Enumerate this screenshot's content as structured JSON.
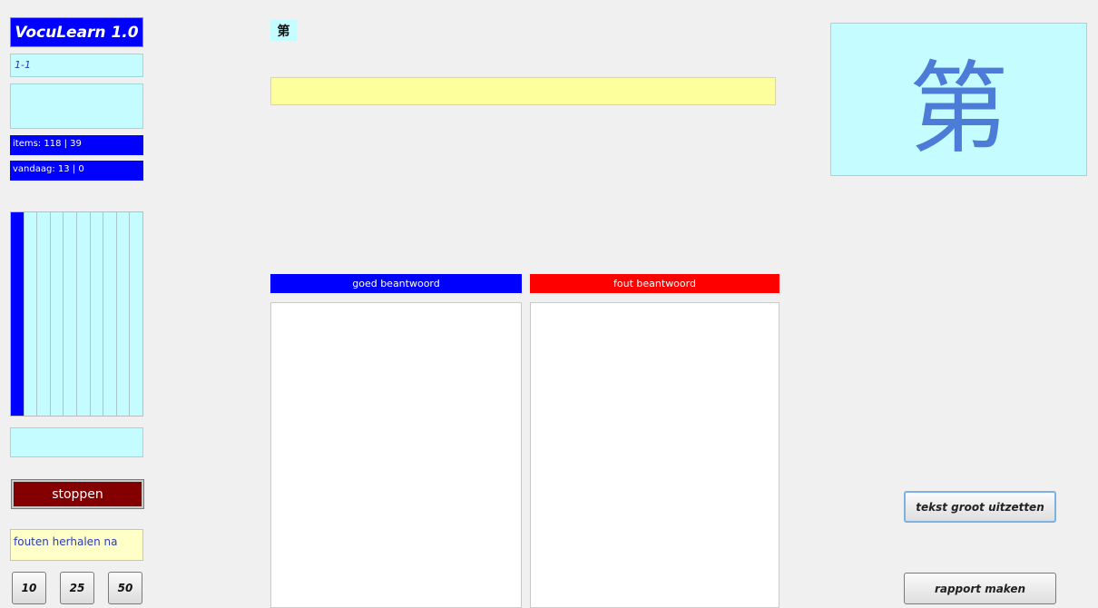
{
  "app": {
    "title": "VocuLearn 1.0"
  },
  "sidebar": {
    "lesson": "1-1",
    "items_stat": "items: 118 | 39",
    "today_stat": "vandaag: 13 | 0",
    "progress_bars": [
      1.0,
      0,
      0,
      0,
      0,
      0,
      0,
      0,
      0,
      0
    ],
    "stop_label": "stoppen",
    "repeat_label": "fouten herhalen na",
    "repeat_options": [
      "10",
      "25",
      "50"
    ]
  },
  "main": {
    "character": "第",
    "good_header": "goed beantwoord",
    "bad_header": "fout beantwoord"
  },
  "right": {
    "character": "第",
    "large_text_button": "tekst groot uitzetten",
    "report_button": "rapport maken"
  },
  "colors": {
    "blue": "#0000ff",
    "red": "#ff0000",
    "cyan": "#c5fcff",
    "yellow": "#fcff9c",
    "stop": "#840000"
  }
}
